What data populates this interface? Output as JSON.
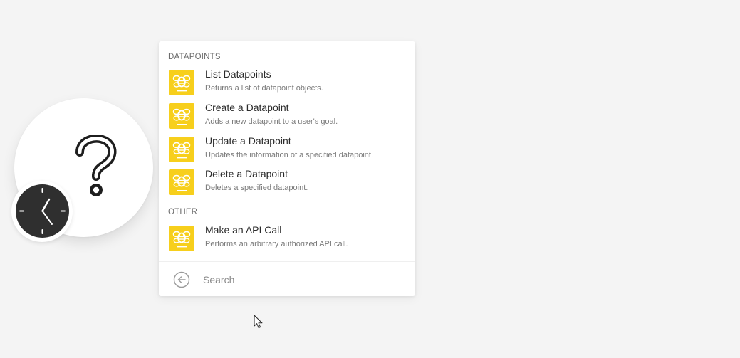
{
  "panel": {
    "sections": [
      {
        "header": "DATAPOINTS",
        "items": [
          {
            "title": "List Datapoints",
            "description": "Returns a list of datapoint objects."
          },
          {
            "title": "Create a Datapoint",
            "description": "Adds a new datapoint to a user's goal."
          },
          {
            "title": "Update a Datapoint",
            "description": "Updates the information of a specified datapoint."
          },
          {
            "title": "Delete a Datapoint",
            "description": "Deletes a specified datapoint."
          }
        ]
      },
      {
        "header": "OTHER",
        "items": [
          {
            "title": "Make an API Call",
            "description": "Performs an arbitrary authorized API call."
          }
        ]
      }
    ],
    "item_icon": "beeminder-bee-icon",
    "item_icon_color": "#f7cf1c"
  },
  "search": {
    "placeholder": "Search",
    "back_icon": "arrow-left-circle-icon"
  },
  "module": {
    "icon": "question-mark-icon",
    "badge_icon": "clock-icon"
  }
}
